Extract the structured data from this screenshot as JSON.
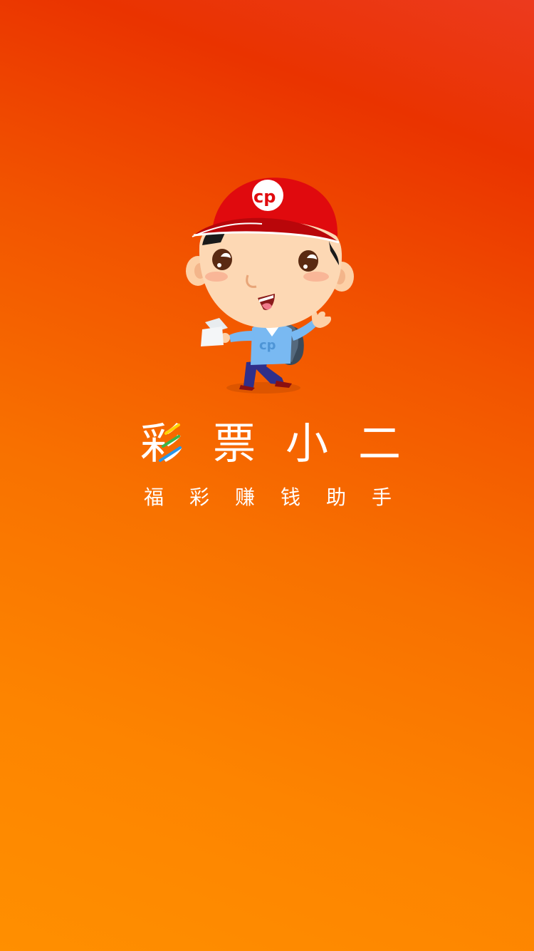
{
  "app": {
    "title_chars": [
      "彩",
      "票",
      "小",
      "二"
    ],
    "subtitle_chars": [
      "福",
      "彩",
      "赚",
      "钱",
      "助",
      "手"
    ]
  },
  "mascot": {
    "icon": "lottery-delivery-boy-icon",
    "cap_logo": "cwl-logo-icon"
  },
  "colors": {
    "background_top": "#ea3300",
    "background_bottom": "#ff8f00",
    "text": "#ffffff",
    "cap": "#d9070b",
    "accent_yellow": "#ffd400",
    "accent_green": "#3ab54a",
    "accent_blue": "#2996e8"
  }
}
